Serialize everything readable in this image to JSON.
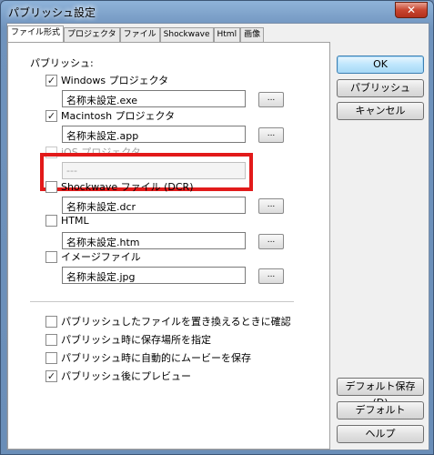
{
  "window": {
    "title": "パブリッシュ設定",
    "close_glyph": "✕"
  },
  "tabs": [
    {
      "label": "ファイル形式",
      "active": true
    },
    {
      "label": "プロジェクタ",
      "active": false
    },
    {
      "label": "ファイル",
      "active": false
    },
    {
      "label": "Shockwave",
      "active": false
    },
    {
      "label": "Html",
      "active": false
    },
    {
      "label": "画像",
      "active": false
    }
  ],
  "publish_group": {
    "label": "パブリッシュ:",
    "formats": [
      {
        "label": "Windows プロジェクタ",
        "checked": true,
        "disabled": false,
        "filename": "名称未設定.exe"
      },
      {
        "label": "Macintosh プロジェクタ",
        "checked": true,
        "disabled": false,
        "filename": "名称未設定.app"
      },
      {
        "label": "iOS プロジェクタ",
        "checked": false,
        "disabled": true,
        "filename": "---"
      },
      {
        "label": "Shockwave ファイル (DCR)",
        "checked": false,
        "disabled": false,
        "filename": "名称未設定.dcr"
      },
      {
        "label": "HTML",
        "checked": false,
        "disabled": false,
        "filename": "名称未設定.htm"
      },
      {
        "label": "イメージファイル",
        "checked": false,
        "disabled": false,
        "filename": "名称未設定.jpg"
      }
    ],
    "browse_label": "..."
  },
  "options": [
    {
      "label": "パブリッシュしたファイルを置き換えるときに確認",
      "checked": false
    },
    {
      "label": "パブリッシュ時に保存場所を指定",
      "checked": false
    },
    {
      "label": "パブリッシュ時に自動的にムービーを保存",
      "checked": false
    },
    {
      "label": "パブリッシュ後にプレビュー",
      "checked": true
    }
  ],
  "buttons": {
    "ok": "OK",
    "publish": "パブリッシュ",
    "cancel": "キャンセル",
    "save_default": "デフォルト保存(D)",
    "default": "デフォルト",
    "help": "ヘルプ"
  },
  "check_glyph": "✓"
}
